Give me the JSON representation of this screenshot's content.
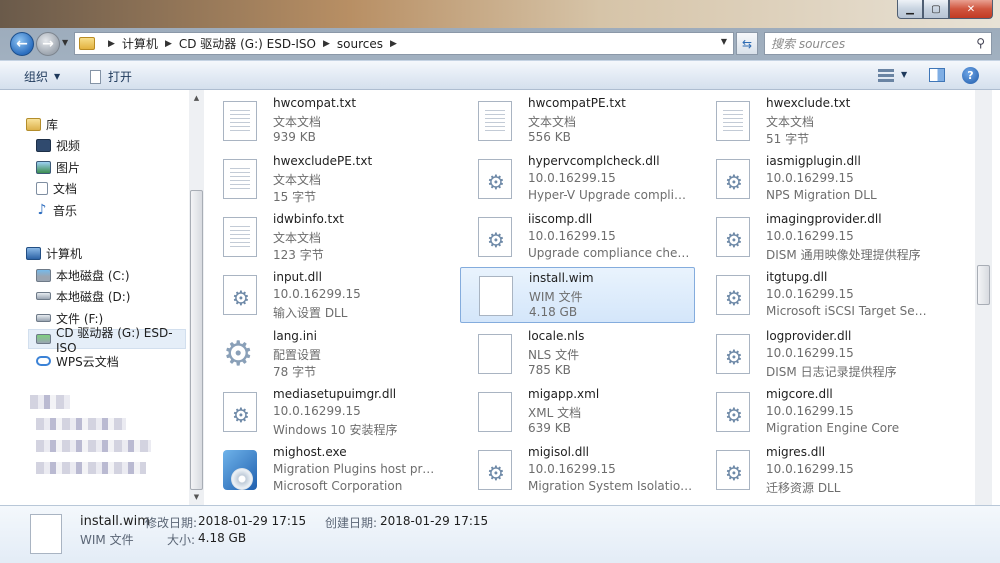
{
  "window": {
    "controls": {
      "minimize": "▁",
      "maximize": "▢",
      "close": "✕"
    }
  },
  "address": {
    "crumbs": [
      "计算机",
      "CD 驱动器 (G:) ESD-ISO",
      "sources"
    ],
    "search_placeholder": "搜索 sources"
  },
  "toolbar": {
    "organize": "组织",
    "open": "打开"
  },
  "nav": {
    "library": "库",
    "video": "视频",
    "pictures": "图片",
    "documents": "文档",
    "music": "音乐",
    "computer": "计算机",
    "disk_c": "本地磁盘 (C:)",
    "disk_d": "本地磁盘 (D:)",
    "disk_f": "文件 (F:)",
    "cd_g": "CD 驱动器 (G:) ESD-ISO",
    "wps": "WPS云文档"
  },
  "files": [
    {
      "name": "hwcompat.txt",
      "l1": "文本文档",
      "l2": "939 KB",
      "icon": "txt"
    },
    {
      "name": "hwcompatPE.txt",
      "l1": "文本文档",
      "l2": "556 KB",
      "icon": "txt"
    },
    {
      "name": "hwexclude.txt",
      "l1": "文本文档",
      "l2": "51 字节",
      "icon": "txt"
    },
    {
      "name": "hwexcludePE.txt",
      "l1": "文本文档",
      "l2": "15 字节",
      "icon": "txt"
    },
    {
      "name": "hypervcomplcheck.dll",
      "l1": "10.0.16299.15",
      "l2": "Hyper-V Upgrade compliance ...",
      "icon": "dll"
    },
    {
      "name": "iasmigplugin.dll",
      "l1": "10.0.16299.15",
      "l2": "NPS Migration DLL",
      "icon": "dll"
    },
    {
      "name": "idwbinfo.txt",
      "l1": "文本文档",
      "l2": "123 字节",
      "icon": "txt"
    },
    {
      "name": "iiscomp.dll",
      "l1": "10.0.16299.15",
      "l2": "Upgrade compliance check m...",
      "icon": "dll"
    },
    {
      "name": "imagingprovider.dll",
      "l1": "10.0.16299.15",
      "l2": "DISM 通用映像处理提供程序",
      "icon": "dll"
    },
    {
      "name": "input.dll",
      "l1": "10.0.16299.15",
      "l2": "输入设置 DLL",
      "icon": "dll"
    },
    {
      "name": "install.wim",
      "l1": "WIM 文件",
      "l2": "4.18 GB",
      "icon": "blank",
      "selected": true
    },
    {
      "name": "itgtupg.dll",
      "l1": "10.0.16299.15",
      "l2": "Microsoft iSCSI Target Server ...",
      "icon": "dll"
    },
    {
      "name": "lang.ini",
      "l1": "配置设置",
      "l2": "78 字节",
      "icon": "ini"
    },
    {
      "name": "locale.nls",
      "l1": "NLS 文件",
      "l2": "785 KB",
      "icon": "blank"
    },
    {
      "name": "logprovider.dll",
      "l1": "10.0.16299.15",
      "l2": "DISM 日志记录提供程序",
      "icon": "dll"
    },
    {
      "name": "mediasetupuimgr.dll",
      "l1": "10.0.16299.15",
      "l2": "Windows 10 安装程序",
      "icon": "dll"
    },
    {
      "name": "migapp.xml",
      "l1": "XML 文档",
      "l2": "639 KB",
      "icon": "blank"
    },
    {
      "name": "migcore.dll",
      "l1": "10.0.16299.15",
      "l2": "Migration Engine Core",
      "icon": "dll"
    },
    {
      "name": "mighost.exe",
      "l1": "Migration Plugins host program",
      "l2": "Microsoft Corporation",
      "icon": "exe"
    },
    {
      "name": "migisol.dll",
      "l1": "10.0.16299.15",
      "l2": "Migration System Isolation La...",
      "icon": "dll"
    },
    {
      "name": "migres.dll",
      "l1": "10.0.16299.15",
      "l2": "迁移资源 DLL",
      "icon": "dll"
    }
  ],
  "details": {
    "name": "install.wim",
    "type": "WIM 文件",
    "modified_label": "修改日期:",
    "modified": "2018-01-29 17:15",
    "created_label": "创建日期:",
    "created": "2018-01-29 17:15",
    "size_label": "大小:",
    "size": "4.18 GB"
  }
}
